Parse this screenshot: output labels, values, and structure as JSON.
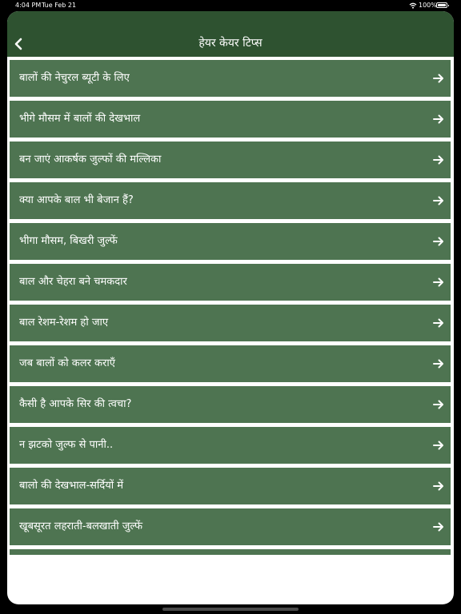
{
  "status_bar": {
    "time": "4:04 PM",
    "date": "Tue Feb 21",
    "battery_percent": "100%",
    "icons": [
      "wifi-icon",
      "battery-icon"
    ]
  },
  "nav": {
    "title": "हेयर केयर टिप्स",
    "back_icon": "chevron-left-icon"
  },
  "colors": {
    "nav_background": "#2e5230",
    "row_background": "#4e7451",
    "row_text": "#ffffff",
    "content_background": "#ffffff"
  },
  "list": {
    "row_icon": "arrow-right-icon",
    "items": [
      {
        "label": "बालों की नेचुरल ब्यूटी के लिए"
      },
      {
        "label": "भीगे मौसम में बालों की देखभाल"
      },
      {
        "label": "बन जाएं आकर्षक जुल्फों की मल्लिका"
      },
      {
        "label": "क्या आपके बाल भी बेजान हैं?"
      },
      {
        "label": "भीगा मौसम, बिखरी जुल्फें"
      },
      {
        "label": "बाल और चेहरा बने चमकदार"
      },
      {
        "label": "बाल रेशम-रेशम हो जाए"
      },
      {
        "label": "जब बालों को कलर कराएँ"
      },
      {
        "label": "कैसी है आपके सिर की त्वचा?"
      },
      {
        "label": "न झटको जुल्फ से पानी.."
      },
      {
        "label": "बालो की देखभाल-सर्दियों में"
      },
      {
        "label": "खूबसूरत लहराती-बलखाती जुल्फें"
      },
      {
        "label": ""
      }
    ]
  }
}
